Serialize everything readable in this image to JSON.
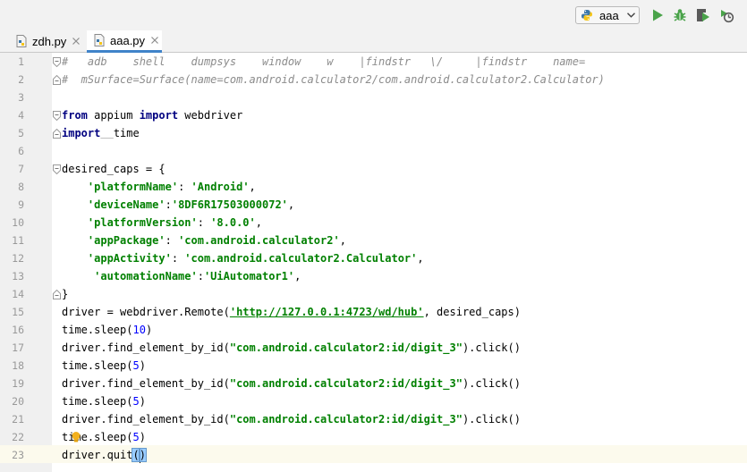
{
  "toolbar": {
    "run_config_label": "aaa",
    "run_config_icon": "python-file-icon",
    "buttons": [
      "run-icon",
      "debug-icon",
      "run-with-coverage-icon",
      "profile-icon"
    ],
    "colors": {
      "run": "#4aa34a",
      "debug": "#4aa34a"
    }
  },
  "tabs": [
    {
      "label": "zdh.py",
      "active": false
    },
    {
      "label": "aaa.py",
      "active": true
    }
  ],
  "editor": {
    "caret_line": 23,
    "lines": [
      {
        "n": "1",
        "text": "#   adb    shell    dumpsys    window    w    |findstr   \\/     |findstr    name="
      },
      {
        "n": "2",
        "text": "#  mSurface=Surface(name=com.android.calculator2/com.android.calculator2.Calculator)"
      },
      {
        "n": "3",
        "text": ""
      },
      {
        "n": "4",
        "parts": [
          "from",
          " appium ",
          "import",
          " webdriver"
        ]
      },
      {
        "n": "5",
        "parts": [
          "import",
          "  ",
          "time"
        ]
      },
      {
        "n": "6",
        "text": ""
      },
      {
        "n": "7",
        "text": "desired_caps = {"
      },
      {
        "n": "8",
        "parts": [
          "    ",
          "'platformName'",
          ": ",
          "'Android'",
          ","
        ]
      },
      {
        "n": "9",
        "parts": [
          "    ",
          "'deviceName'",
          ":",
          "'8DF6R17503000072'",
          ","
        ]
      },
      {
        "n": "10",
        "parts": [
          "    ",
          "'platformVersion'",
          ": ",
          "'8.0.0'",
          ","
        ]
      },
      {
        "n": "11",
        "parts": [
          "    ",
          "'appPackage'",
          ": ",
          "'com.android.calculator2'",
          ","
        ]
      },
      {
        "n": "12",
        "parts": [
          "    ",
          "'appActivity'",
          ": ",
          "'com.android.calculator2.Calculator'",
          ","
        ]
      },
      {
        "n": "13",
        "parts": [
          "     ",
          "'automationName'",
          ":",
          "'UiAutomator1'",
          ","
        ]
      },
      {
        "n": "14",
        "text": "}"
      },
      {
        "n": "15",
        "parts": [
          "driver = webdriver.Remote(",
          "'http://127.0.0.1:4723/wd/hub'",
          ", desired_caps)"
        ]
      },
      {
        "n": "16",
        "parts": [
          "time.sleep(",
          "10",
          ")"
        ]
      },
      {
        "n": "17",
        "parts": [
          "driver.find_element_by_id(",
          "\"com.android.calculator2:id/digit_3\"",
          ").click()"
        ]
      },
      {
        "n": "18",
        "parts": [
          "time.sleep(",
          "5",
          ")"
        ]
      },
      {
        "n": "19",
        "parts": [
          "driver.find_element_by_id(",
          "\"com.android.calculator2:id/digit_3\"",
          ").click()"
        ]
      },
      {
        "n": "20",
        "parts": [
          "time.sleep(",
          "5",
          ")"
        ]
      },
      {
        "n": "21",
        "parts": [
          "driver.find_element_by_id(",
          "\"com.android.calculator2:id/digit_3\"",
          ").click()"
        ]
      },
      {
        "n": "22",
        "parts": [
          "time.sleep(",
          "5",
          ")"
        ]
      },
      {
        "n": "23",
        "parts": [
          "driver.quit",
          "(",
          ")"
        ]
      }
    ]
  },
  "colors": {
    "comment": "#8c8c8c",
    "keyword": "#000080",
    "string": "#008000",
    "number": "#0000ff",
    "gutter_bg": "#f0f0f0",
    "caret_line_bg": "#fcfaed",
    "active_tab_underline": "#4083c9"
  }
}
